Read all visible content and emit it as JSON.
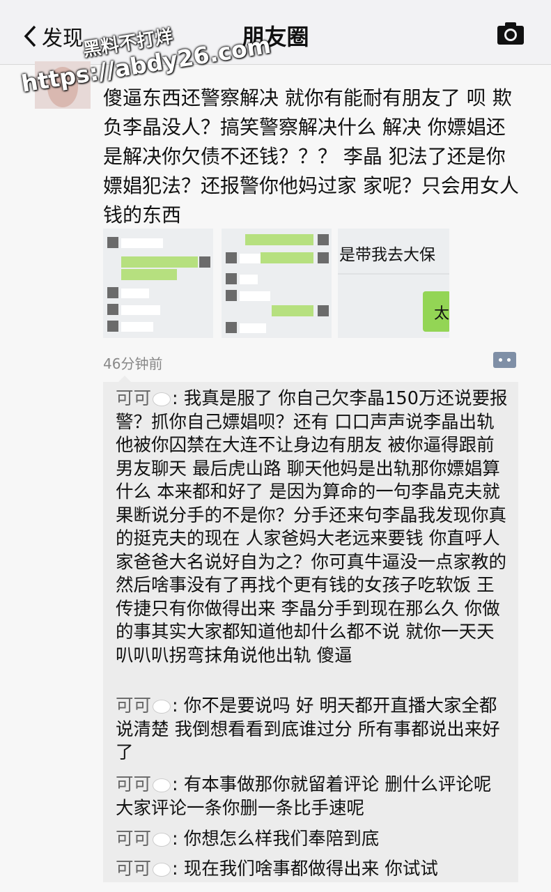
{
  "nav": {
    "back_label": "发现",
    "title": "朋友圈"
  },
  "watermark": {
    "line1": "黑料不打烊",
    "line2": "https://abdy26.com"
  },
  "post": {
    "text": "傻逼东西还警察解决 就你有能耐有朋友了 呗 欺负李晶没人？搞笑警察解决什么 解决 你嫖娼还是解决你欠债不还钱？？？ 李晶 犯法了还是你嫖娼犯法？还报警你他妈过家 家呢？只会用女人钱的东西",
    "image3_text_top": "是带我去大保",
    "image3_text_bubble": "太",
    "timestamp": "46分钟前"
  },
  "comments": [
    {
      "name": "可可",
      "text": ": 我真是服了 你自己欠李晶150万还说要报警？抓你自己嫖娼呗？还有 口口声声说李晶出轨 他被你囚禁在大连不让身边有朋友 被你逼得跟前男友聊天 最后虎山路 聊天他妈是出轨那你嫖娼算什么 本来都和好了 是因为算命的一句李晶克夫就果断说分手的不是你？分手还来句李晶我发现你真的挺克夫的现在 人家爸妈大老远来要钱 你直呼人家爸爸大名说好自为之？你可真牛逼没一点家教的  然后啥事没有了再找个更有钱的女孩子吃软饭 王传捷只有你做得出来 李晶分手到现在那么久 你做的事其实大家都知道他却什么都不说 就你一天天叭叭叭拐弯抹角说他出轨 傻逼"
    },
    {
      "name": "可可",
      "text": ": 你不是要说吗 好 明天都开直播大家全都说清楚 我倒想看看到底谁过分 所有事都说出来好了"
    },
    {
      "name": "可可",
      "text": ": 有本事做那你就留着评论 删什么评论呢 大家评论一条你删一条比手速呢"
    },
    {
      "name": "可可",
      "text": ": 你想怎么样我们奉陪到底"
    },
    {
      "name": "可可",
      "text": ": 现在我们啥事都做得出来 你试试"
    }
  ]
}
